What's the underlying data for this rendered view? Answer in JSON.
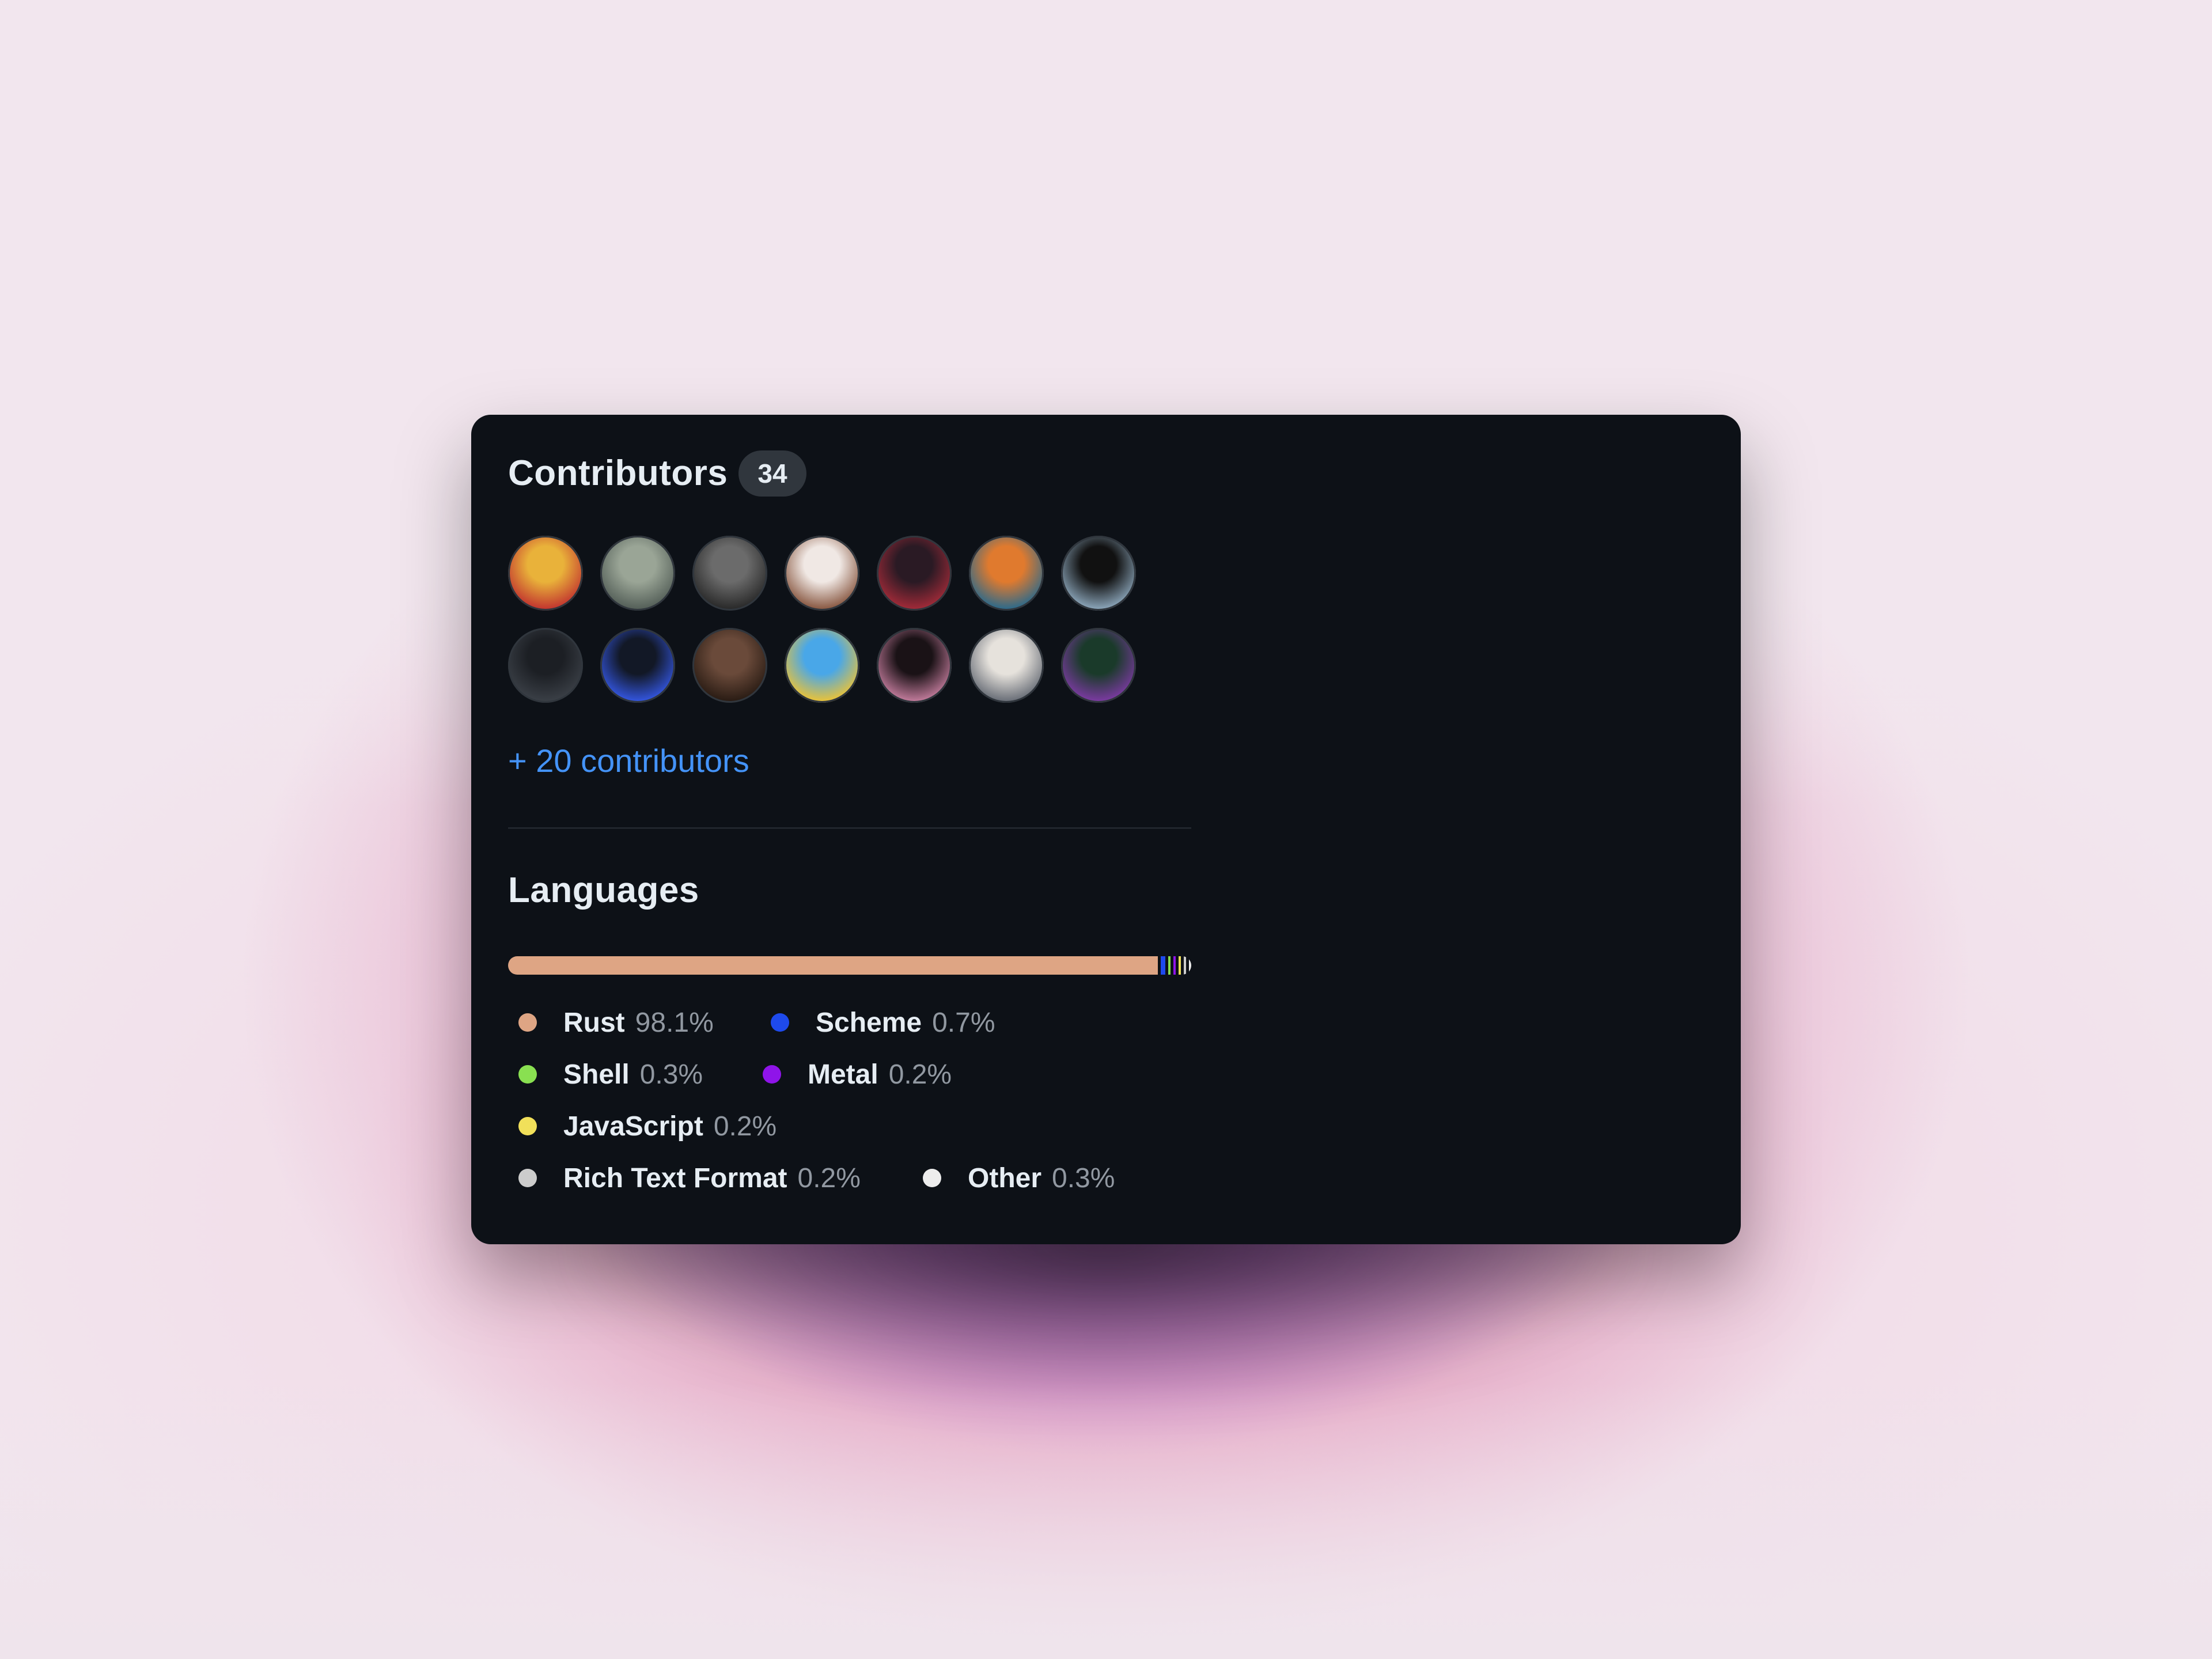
{
  "contributors": {
    "title": "Contributors",
    "count": "34",
    "more_link": "+ 20 contributors",
    "avatars": [
      {
        "name": "avatar-1",
        "colors": [
          "#e9b23a",
          "#c2362f"
        ]
      },
      {
        "name": "avatar-2",
        "colors": [
          "#9aa596",
          "#556059"
        ]
      },
      {
        "name": "avatar-3",
        "colors": [
          "#6b6b6b",
          "#2a2a2a"
        ]
      },
      {
        "name": "avatar-4",
        "colors": [
          "#f0e8e4",
          "#8a5a44"
        ]
      },
      {
        "name": "avatar-5",
        "colors": [
          "#2a1a24",
          "#a02a38"
        ]
      },
      {
        "name": "avatar-6",
        "colors": [
          "#e07a2e",
          "#2e6a8a"
        ]
      },
      {
        "name": "avatar-7",
        "colors": [
          "#111111",
          "#8aa4b8"
        ]
      },
      {
        "name": "avatar-8",
        "colors": [
          "#1c1f24",
          "#3a3f46"
        ]
      },
      {
        "name": "avatar-9",
        "colors": [
          "#121826",
          "#3355dd"
        ]
      },
      {
        "name": "avatar-10",
        "colors": [
          "#6a4a3a",
          "#2a1c14"
        ]
      },
      {
        "name": "avatar-11",
        "colors": [
          "#49a7e8",
          "#e8c23a"
        ]
      },
      {
        "name": "avatar-12",
        "colors": [
          "#1a1216",
          "#c07a9a"
        ]
      },
      {
        "name": "avatar-13",
        "colors": [
          "#e6e2dc",
          "#6a6f78"
        ]
      },
      {
        "name": "avatar-14",
        "colors": [
          "#1a3a2a",
          "#7a3aa0"
        ]
      }
    ]
  },
  "languages": {
    "title": "Languages",
    "items": [
      {
        "name": "Rust",
        "percent": "98.1%",
        "value": 98.1,
        "color": "#dea584"
      },
      {
        "name": "Scheme",
        "percent": "0.7%",
        "value": 0.7,
        "color": "#1e4aec"
      },
      {
        "name": "Shell",
        "percent": "0.3%",
        "value": 0.3,
        "color": "#89e051"
      },
      {
        "name": "Metal",
        "percent": "0.2%",
        "value": 0.2,
        "color": "#8f14e9"
      },
      {
        "name": "JavaScript",
        "percent": "0.2%",
        "value": 0.2,
        "color": "#f1e05a"
      },
      {
        "name": "Rich Text Format",
        "percent": "0.2%",
        "value": 0.2,
        "color": "#cccccc"
      },
      {
        "name": "Other",
        "percent": "0.3%",
        "value": 0.3,
        "color": "#ededed"
      }
    ]
  }
}
